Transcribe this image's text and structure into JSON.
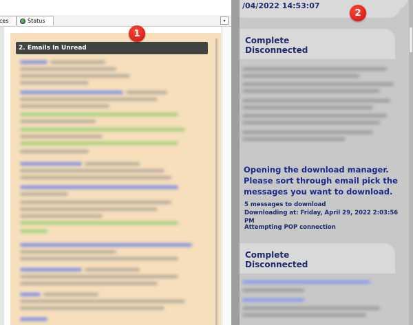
{
  "tabs": [
    {
      "label": "ces"
    },
    {
      "label": "Status"
    }
  ],
  "tab_dropdown_glyph": "▾",
  "left_panel": {
    "header": "2. Emails In Unread"
  },
  "right_panel": {
    "date_line": "/04/2022 14:53:07",
    "status_complete": "Complete",
    "status_disconnected": "Disconnected",
    "download_manager_message": "Opening the download manager. Please sort through email pick the messages you want to download.",
    "messages_to_download": "5 messages to download",
    "downloading_at": "Downloading at: Friday, April 29, 2022 2:03:56 PM",
    "pop_connection": "Attempting POP connection"
  },
  "badges": [
    "1",
    "2"
  ],
  "colors": {
    "panel_bg": "#f7dfbc",
    "header_bg": "#434343",
    "right_bg": "#c8c8c8",
    "bubble_bg": "#d9d9d9",
    "text_navy": "#1a2a8c",
    "badge_red": "#e11d1d"
  },
  "icons": {
    "status_tab_icon": "globe-icon",
    "tab_menu_icon": "chevron-down-icon"
  }
}
